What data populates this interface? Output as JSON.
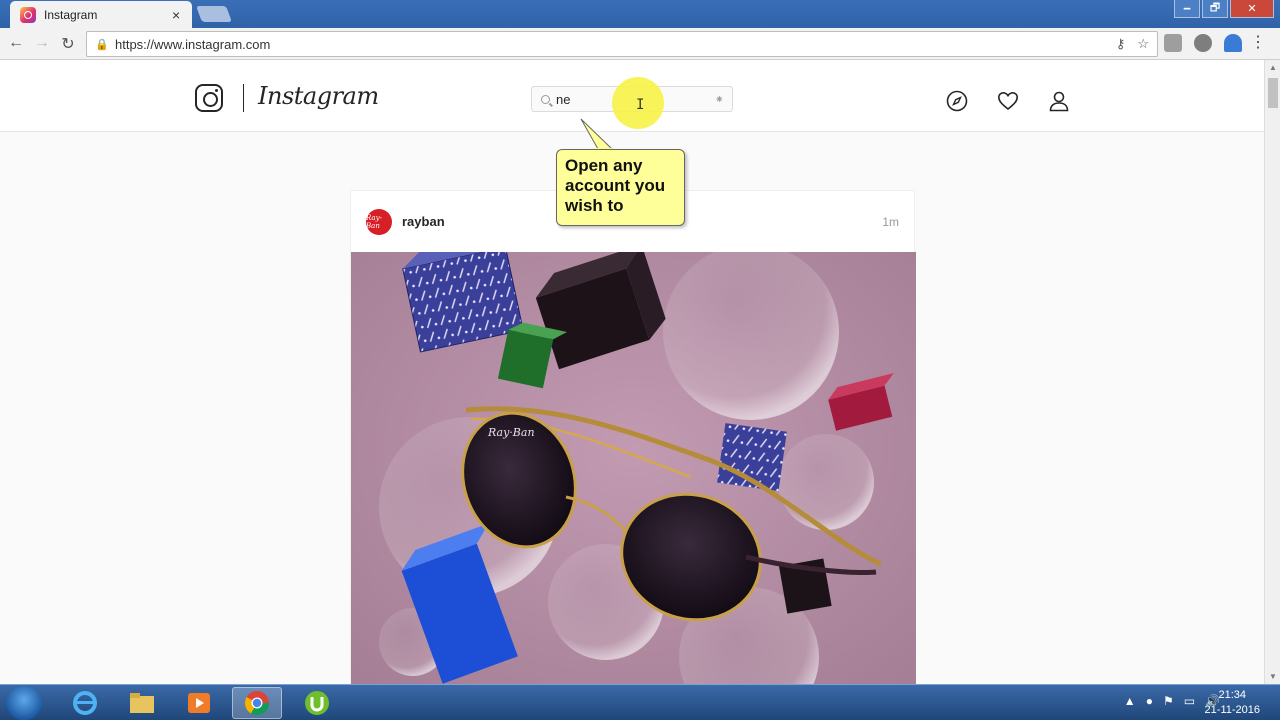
{
  "browser": {
    "tab_title": "Instagram",
    "tab_close": "×",
    "url": "https://www.instagram.com",
    "window_buttons": [
      "🗕",
      "🗗",
      "✕"
    ]
  },
  "instagram": {
    "wordmark": "Instagram",
    "search": {
      "value": "ne",
      "spinner": "⁕"
    },
    "nav_icons": [
      "compass-icon",
      "heart-icon",
      "profile-icon"
    ]
  },
  "callout": {
    "text": "Open any account you wish to"
  },
  "post": {
    "username": "rayban",
    "time": "1m",
    "avatar_text": "Ray-Ban"
  },
  "taskbar": {
    "apps": [
      "internet-explorer",
      "file-explorer",
      "media-player",
      "chrome",
      "utorrent"
    ],
    "time": "21:34",
    "date": "21-11-2016"
  },
  "colors": {
    "instagram_text": "#262626",
    "highlight": "#f7f24a",
    "callout_bg": "#ffff99",
    "post_bg": "#b08ba2",
    "rayban_red": "#d71f26"
  }
}
